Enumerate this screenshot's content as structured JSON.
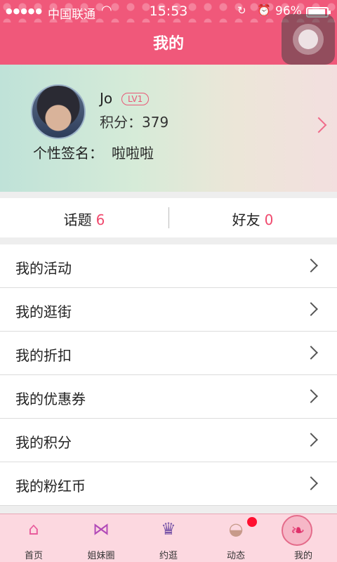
{
  "status_bar": {
    "signal": "●●●●●",
    "carrier": "中国联通",
    "time": "15:53",
    "battery": "96%"
  },
  "header": {
    "title": "我的"
  },
  "profile": {
    "name": "Jo",
    "level": "LV1",
    "points_label": "积分：",
    "points_value": "379",
    "signature_label": "个性签名：",
    "signature_value": "啦啦啦"
  },
  "stats": [
    {
      "label": "话题",
      "value": "6"
    },
    {
      "label": "好友",
      "value": "0"
    }
  ],
  "menu": [
    {
      "label": "我的活动"
    },
    {
      "label": "我的逛街"
    },
    {
      "label": "我的折扣"
    },
    {
      "label": "我的优惠券"
    },
    {
      "label": "我的积分"
    },
    {
      "label": "我的粉红币"
    }
  ],
  "tabbar": {
    "items": [
      {
        "label": "首页",
        "icon": "house-icon"
      },
      {
        "label": "姐妹圈",
        "icon": "bow-icon"
      },
      {
        "label": "约逛",
        "icon": "shopper-icon"
      },
      {
        "label": "动态",
        "icon": "compact-icon",
        "has_badge": true
      },
      {
        "label": "我的",
        "icon": "heel-icon",
        "active": true
      }
    ]
  },
  "colors": {
    "brand": "#f0587a",
    "accent_number": "#f04a6e",
    "badge": "#ff1030"
  }
}
